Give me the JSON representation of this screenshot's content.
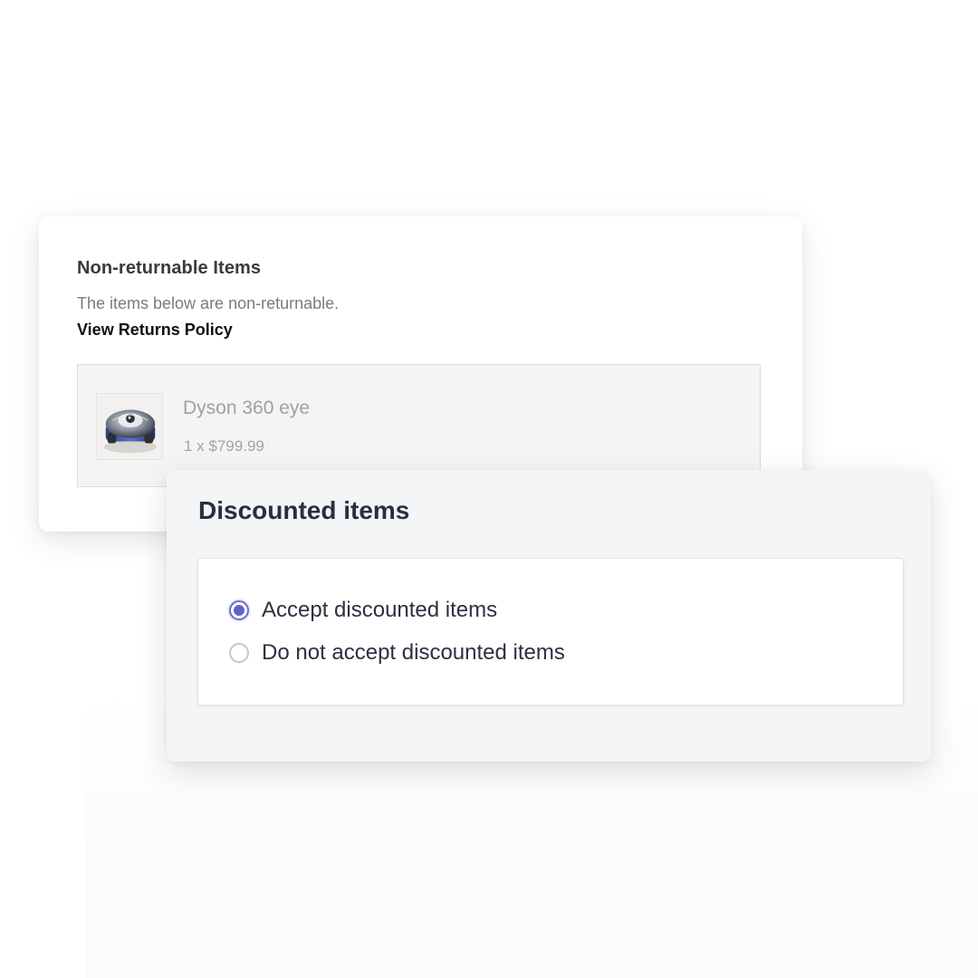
{
  "nonreturnable": {
    "title": "Non-returnable Items",
    "description": "The items below are non-returnable.",
    "policy_link": "View Returns Policy",
    "product": {
      "name": "Dyson 360 eye",
      "quantity_price": "1 x $799.99",
      "image_icon": "robot-vacuum-icon"
    }
  },
  "discounted": {
    "title": "Discounted items",
    "options": [
      {
        "label": "Accept discounted items",
        "selected": true
      },
      {
        "label": "Do not accept discounted items",
        "selected": false
      }
    ]
  },
  "colors": {
    "accent": "#5f63c4",
    "title_dark": "#263040",
    "muted_text": "#a0a0a0",
    "card_bg": "#f4f5f7"
  }
}
